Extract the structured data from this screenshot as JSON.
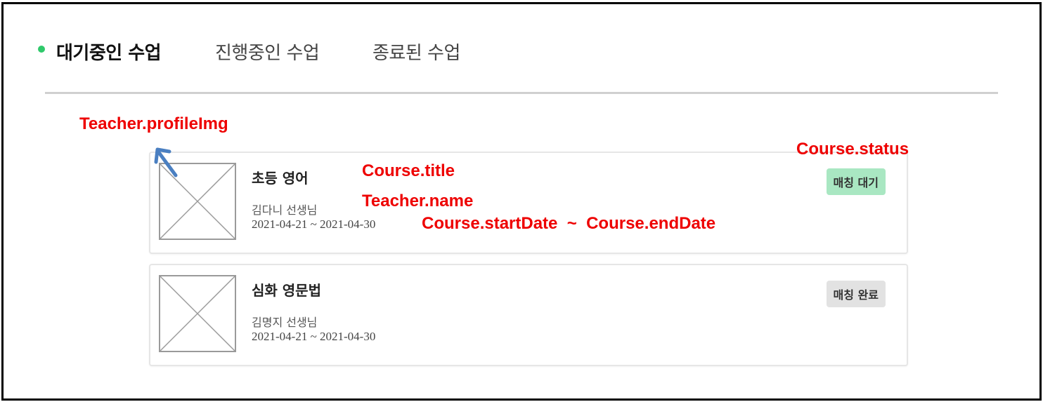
{
  "tabs": [
    {
      "label": "대기중인 수업",
      "active": true
    },
    {
      "label": "진행중인 수업",
      "active": false
    },
    {
      "label": "종료된 수업",
      "active": false
    }
  ],
  "cards": [
    {
      "title": "초등 영어",
      "teacher": "김다니 선생님",
      "dates": "2021-04-21 ~ 2021-04-30",
      "status": "매칭 대기"
    },
    {
      "title": "심화 영문법",
      "teacher": "김명지 선생님",
      "dates": "2021-04-21 ~ 2021-04-30",
      "status": "매칭 완료"
    }
  ],
  "annotations": {
    "profile_img": "Teacher.profileImg",
    "title": "Course.title",
    "status": "Course.status",
    "name": "Teacher.name",
    "dates": "Course.startDate  ~  Course.endDate"
  },
  "colors": {
    "active_dot": "#2fc96b",
    "waiting_badge": "#a9e7c2",
    "done_badge": "#e2e2e2",
    "annotation": "#ee0000",
    "arrow": "#4a7fc1"
  },
  "icons": {
    "image_placeholder": "image-placeholder-icon",
    "arrow": "arrow-up-left-icon"
  }
}
